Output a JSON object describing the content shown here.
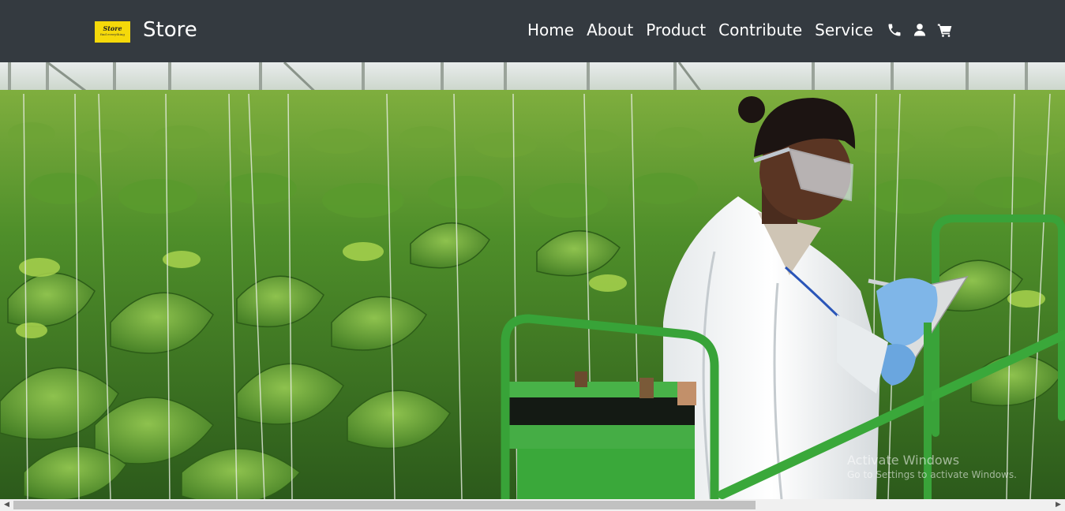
{
  "header": {
    "logo": {
      "main_text": "Store",
      "sub_text": "find everything"
    },
    "brand": "Store",
    "nav": [
      {
        "label": "Home"
      },
      {
        "label": "About"
      },
      {
        "label": "Product"
      },
      {
        "label": "Contribute"
      },
      {
        "label": "Service"
      }
    ],
    "icons": [
      "phone-icon",
      "user-icon",
      "cart-icon"
    ]
  },
  "hero": {
    "image": "greenhouse-scientist-photo"
  },
  "watermark": {
    "title": "Activate Windows",
    "subtitle": "Go to Settings to activate Windows."
  },
  "colors": {
    "navbar_bg": "#343a40",
    "logo_bg": "#f5d90a",
    "nav_text": "#ffffff",
    "plant_green": "#4f8f2a",
    "cart_green": "#3aa83a"
  }
}
